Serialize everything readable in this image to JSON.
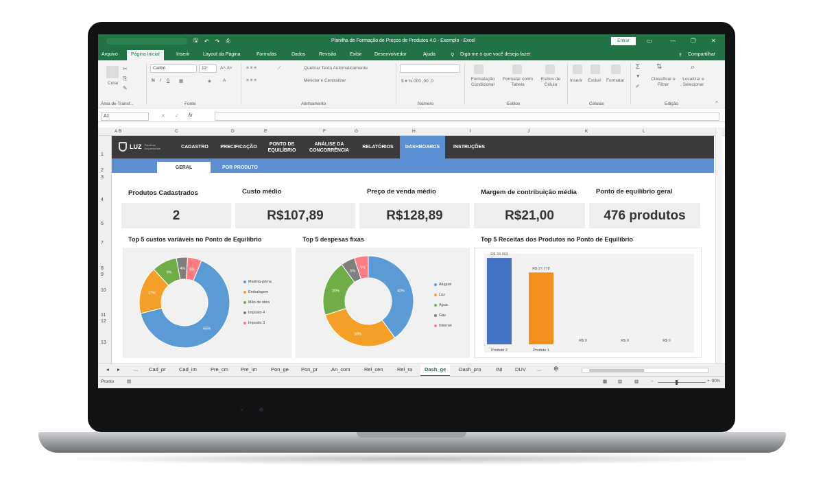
{
  "excel": {
    "title": "Planilha de Formação de Preços de Produtos 4.0 - Exemplo - Excel",
    "entrar": "Entrar",
    "share": "Compartilhar",
    "tell_me": "Diga-me o que você deseja fazer",
    "ribbon_tabs": [
      "Arquivo",
      "Página Inicial",
      "Inserir",
      "Layout da Página",
      "Fórmulas",
      "Dados",
      "Revisão",
      "Exibir",
      "Desenvolvedor",
      "Ajuda"
    ],
    "font_name": "Calibri",
    "font_size": "12",
    "groups": {
      "clipboard": "Área de Transf...",
      "font": "Fonte",
      "alignment": "Alinhamento",
      "number": "Número",
      "styles": "Estilos",
      "cells": "Células",
      "editing": "Edição"
    },
    "ribbon_labels": {
      "paste": "Colar",
      "wrap": "Quebrar Texto Automaticamente",
      "merge": "Mesclar e Centralizar",
      "cond_format": "Formatação Condicional",
      "format_table": "Formatar como Tabela",
      "cell_styles": "Estilos de Célula",
      "insert": "Inserir",
      "delete": "Excluir",
      "format": "Formatar",
      "sort_filter": "Classificar e Filtrar",
      "find_select": "Localizar e Selecionar"
    },
    "name_box": "A1",
    "columns": [
      "A",
      "B",
      "C",
      "D",
      "E",
      "F",
      "G",
      "H",
      "I",
      "J",
      "K",
      "L"
    ],
    "rows": [
      "1",
      "2",
      "3",
      "4",
      "5",
      "7",
      "8",
      "9",
      "10",
      "11",
      "12",
      "13"
    ],
    "sheet_tabs": [
      "...",
      "Cad_pr",
      "Cad_im",
      "Pre_cm",
      "Pre_im",
      "Pon_ge",
      "Pon_pr",
      "An_com",
      "Rel_cen",
      "Rel_ra",
      "Dash_ge",
      "Dash_pro",
      "INI",
      "DUV",
      "..."
    ],
    "status": "Pronto",
    "zoom": "90%"
  },
  "dashboard": {
    "brand": "LUZ",
    "brand_sub": "Planilhas Empresariais",
    "nav": [
      "CADASTRO",
      "PRECIFICAÇÃO",
      "PONTO DE EQUILÍBRIO",
      "ANÁLISE DA CONCORRÊNCIA",
      "RELATÓRIOS",
      "DASHBOARDS",
      "INSTRUÇÕES"
    ],
    "subtabs": [
      "GERAL",
      "POR PRODUTO"
    ],
    "kpis": [
      {
        "label": "Produtos Cadastrados",
        "value": "2"
      },
      {
        "label": "Custo médio",
        "value": "R$107,89"
      },
      {
        "label": "Preço de venda médio",
        "value": "R$128,89"
      },
      {
        "label": "Margem de contribuição média",
        "value": "R$21,00"
      },
      {
        "label": "Ponto de equilíbrio geral",
        "value": "476 produtos"
      }
    ]
  },
  "chart_data": [
    {
      "type": "pie",
      "title": "Top 5 custos variáveis no Ponto de Equilíbrio",
      "categories": [
        "Matéria-prima",
        "Embalagem",
        "Mão de obra",
        "Imposto 4",
        "Imposto 3"
      ],
      "values": [
        65,
        17,
        9,
        4,
        5
      ],
      "labels": [
        "65%",
        "17%",
        "9%",
        "4%",
        "5%"
      ],
      "colors": [
        "#5b9bd5",
        "#f4a028",
        "#70ad47",
        "#7f7f7f",
        "#ff7c80"
      ],
      "legend": "right"
    },
    {
      "type": "pie",
      "title": "Top 5 despesas fixas",
      "categories": [
        "Aluguel",
        "Luz",
        "Água",
        "Gás",
        "Internet"
      ],
      "values": [
        40,
        30,
        20,
        5,
        5
      ],
      "labels": [
        "40%",
        "30%",
        "20%",
        "5%",
        "5%"
      ],
      "colors": [
        "#5b9bd5",
        "#f4a028",
        "#70ad47",
        "#7f7f7f",
        "#ff7c80"
      ],
      "legend": "right"
    },
    {
      "type": "bar",
      "title": "Top 5 Receitas dos Produtos no Ponto de Equilíbrio",
      "categories": [
        "Produto 2",
        "Produto 1",
        "",
        "",
        ""
      ],
      "values": [
        33393,
        27778,
        0,
        0,
        0
      ],
      "data_labels": [
        "R$ 33.393",
        "R$ 27.778",
        "R$ 0",
        "R$ 0",
        "R$ 0"
      ],
      "colors": [
        "#4472c4",
        "#f28e1c"
      ],
      "ylim": [
        0,
        35000
      ]
    }
  ]
}
